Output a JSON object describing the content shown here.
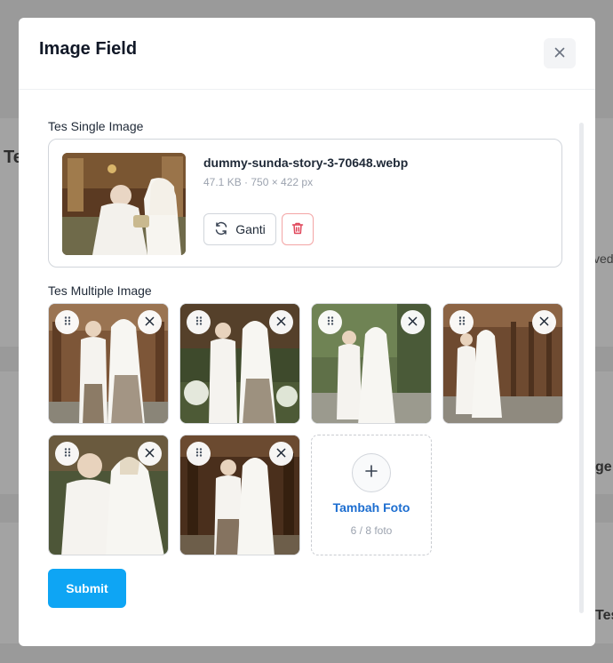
{
  "background": {
    "heading_fragment": "Te",
    "side_text_1": "ved",
    "side_text_2": "ge",
    "side_text_3": "Tes"
  },
  "modal": {
    "title": "Image Field",
    "close_icon": "close-icon"
  },
  "single_field": {
    "label": "Tes Single Image",
    "file_name": "dummy-sunda-story-3-70648.webp",
    "file_meta": "47.1 KB · 750 × 422 px",
    "replace_label": "Ganti",
    "replace_icon": "refresh-icon",
    "delete_icon": "trash-icon"
  },
  "multiple_field": {
    "label": "Tes Multiple Image",
    "add_label": "Tambah Foto",
    "count_text": "6 / 8 foto",
    "drag_icon": "grip-dots-icon",
    "remove_icon": "close-icon"
  },
  "submit_label": "Submit",
  "colors": {
    "primary": "#0ea5f4",
    "link": "#1d6ed0",
    "danger": "#e0465a"
  }
}
